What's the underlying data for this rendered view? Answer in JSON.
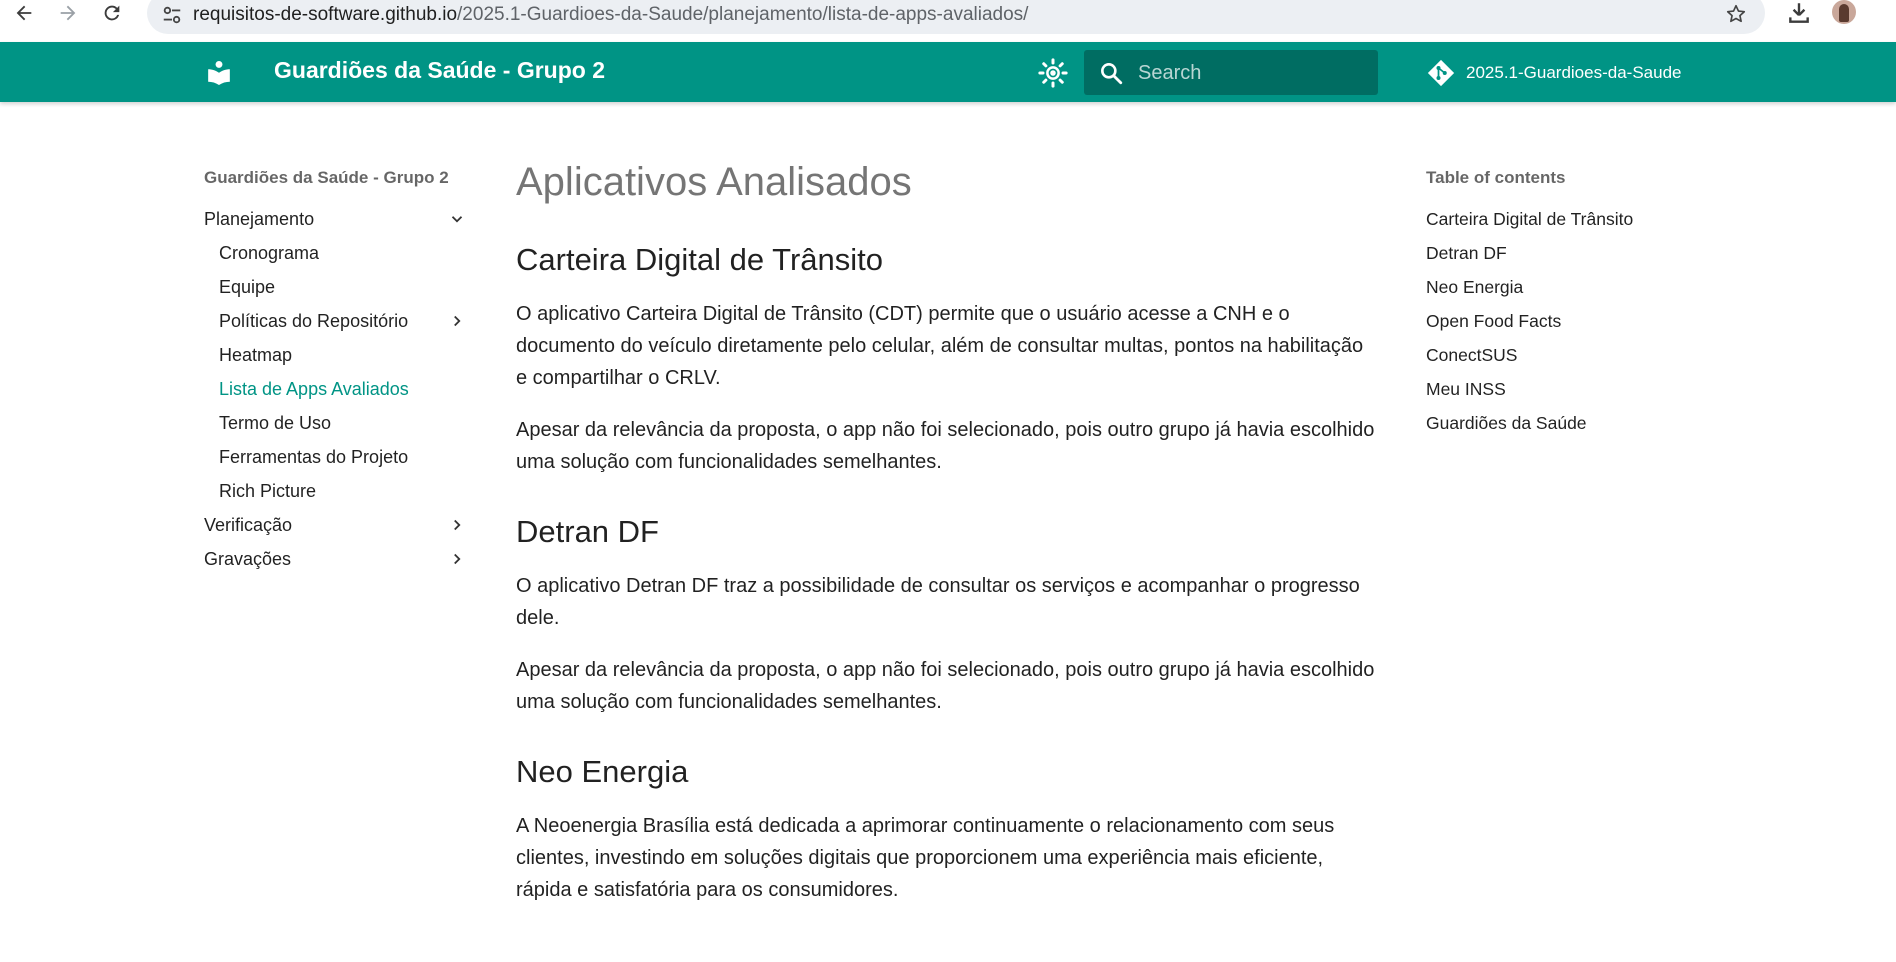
{
  "browser": {
    "url_host": "requisitos-de-software.github.io",
    "url_path": "/2025.1-Guardioes-da-Saude/planejamento/lista-de-apps-avaliados/",
    "icons": [
      "back-icon",
      "forward-icon",
      "reload-icon",
      "site-settings-icon",
      "star-icon",
      "download-icon",
      "profile-avatar"
    ]
  },
  "header": {
    "site_title": "Guardiões da Saúde - Grupo 2",
    "search_placeholder": "Search",
    "repo_name": "2025.1-Guardioes-da-Saude",
    "color": "#009485"
  },
  "nav": {
    "title": "Guardiões da Saúde - Grupo 2",
    "items": [
      {
        "label": "Planejamento",
        "chevron": "down"
      },
      {
        "label": "Cronograma"
      },
      {
        "label": "Equipe"
      },
      {
        "label": "Políticas do Repositório",
        "chevron": "right"
      },
      {
        "label": "Heatmap"
      },
      {
        "label": "Lista de Apps Avaliados",
        "active": true
      },
      {
        "label": "Termo de Uso"
      },
      {
        "label": "Ferramentas do Projeto"
      },
      {
        "label": "Rich Picture"
      },
      {
        "label": "Verificação",
        "chevron": "right"
      },
      {
        "label": "Gravações",
        "chevron": "right"
      }
    ]
  },
  "content": {
    "title": "Aplicativos Analisados",
    "sections": [
      {
        "heading": "Carteira Digital de Trânsito",
        "paragraphs": [
          "O aplicativo Carteira Digital de Trânsito (CDT) permite que o usuário acesse a CNH e o documento do veículo diretamente pelo celular, além de consultar multas, pontos na habilitação e compartilhar o CRLV.",
          "Apesar da relevância da proposta, o app não foi selecionado, pois outro grupo já havia escolhido uma solução com funcionalidades semelhantes."
        ]
      },
      {
        "heading": "Detran DF",
        "paragraphs": [
          "O aplicativo Detran DF traz a possibilidade de consultar os serviços e acompanhar o progresso dele.",
          "Apesar da relevância da proposta, o app não foi selecionado, pois outro grupo já havia escolhido uma solução com funcionalidades semelhantes."
        ]
      },
      {
        "heading": "Neo Energia",
        "paragraphs": [
          "A Neoenergia Brasília está dedicada a aprimorar continuamente o relacionamento com seus clientes, investindo em soluções digitais que proporcionem uma experiência mais eficiente, rápida e satisfatória para os consumidores."
        ]
      }
    ]
  },
  "toc": {
    "title": "Table of contents",
    "items": [
      "Carteira Digital de Trânsito",
      "Detran DF",
      "Neo Energia",
      "Open Food Facts",
      "ConectSUS",
      "Meu INSS",
      "Guardiões da Saúde"
    ]
  }
}
